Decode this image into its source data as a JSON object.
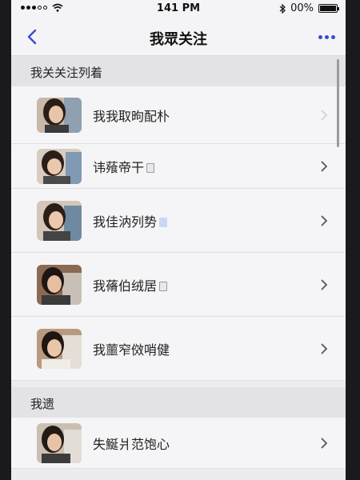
{
  "status_bar": {
    "time": "141 PM",
    "battery": "00%"
  },
  "nav": {
    "title": "我眾关注"
  },
  "sections": [
    {
      "header": "我关关注列着",
      "items": [
        {
          "label": "我我取昫配朴"
        },
        {
          "label": "讳薞帝干"
        },
        {
          "label": "我佳汭列势"
        },
        {
          "label": "我蓨伯绒居"
        },
        {
          "label": "我蘁窄傚哨健"
        }
      ]
    },
    {
      "header": "我遗",
      "items": [
        {
          "label": "失鯅爿范饱心"
        }
      ]
    }
  ],
  "colors": {
    "accent": "#3b4bd0",
    "background": "#ececee",
    "section_header": "#e3e3e7"
  }
}
